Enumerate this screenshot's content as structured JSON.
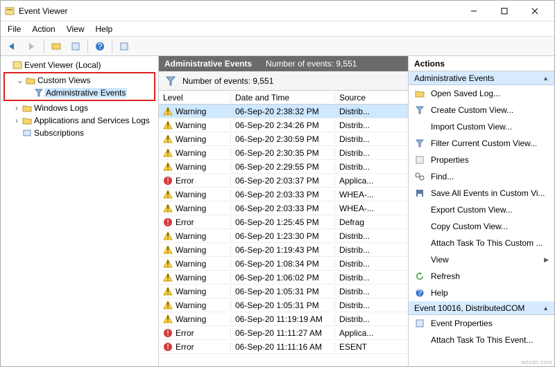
{
  "window": {
    "title": "Event Viewer"
  },
  "menu": [
    "File",
    "Action",
    "View",
    "Help"
  ],
  "tree": {
    "root": "Event Viewer (Local)",
    "custom_views": "Custom Views",
    "admin_events": "Administrative Events",
    "windows_logs": "Windows Logs",
    "apps_logs": "Applications and Services Logs",
    "subscriptions": "Subscriptions"
  },
  "center": {
    "title": "Administrative Events",
    "count_label": "Number of events: 9,551",
    "filter_count": "Number of events: 9,551",
    "columns": {
      "level": "Level",
      "datetime": "Date and Time",
      "source": "Source"
    },
    "rows": [
      {
        "level": "Warning",
        "dt": "06-Sep-20 2:38:32 PM",
        "src": "Distrib..."
      },
      {
        "level": "Warning",
        "dt": "06-Sep-20 2:34:26 PM",
        "src": "Distrib..."
      },
      {
        "level": "Warning",
        "dt": "06-Sep-20 2:30:59 PM",
        "src": "Distrib..."
      },
      {
        "level": "Warning",
        "dt": "06-Sep-20 2:30:35 PM",
        "src": "Distrib..."
      },
      {
        "level": "Warning",
        "dt": "06-Sep-20 2:29:55 PM",
        "src": "Distrib..."
      },
      {
        "level": "Error",
        "dt": "06-Sep-20 2:03:37 PM",
        "src": "Applica..."
      },
      {
        "level": "Warning",
        "dt": "06-Sep-20 2:03:33 PM",
        "src": "WHEA-..."
      },
      {
        "level": "Warning",
        "dt": "06-Sep-20 2:03:33 PM",
        "src": "WHEA-..."
      },
      {
        "level": "Error",
        "dt": "06-Sep-20 1:25:45 PM",
        "src": "Defrag"
      },
      {
        "level": "Warning",
        "dt": "06-Sep-20 1:23:30 PM",
        "src": "Distrib..."
      },
      {
        "level": "Warning",
        "dt": "06-Sep-20 1:19:43 PM",
        "src": "Distrib..."
      },
      {
        "level": "Warning",
        "dt": "06-Sep-20 1:08:34 PM",
        "src": "Distrib..."
      },
      {
        "level": "Warning",
        "dt": "06-Sep-20 1:06:02 PM",
        "src": "Distrib..."
      },
      {
        "level": "Warning",
        "dt": "06-Sep-20 1:05:31 PM",
        "src": "Distrib..."
      },
      {
        "level": "Warning",
        "dt": "06-Sep-20 1:05:31 PM",
        "src": "Distrib..."
      },
      {
        "level": "Warning",
        "dt": "06-Sep-20 11:19:19 AM",
        "src": "Distrib..."
      },
      {
        "level": "Error",
        "dt": "06-Sep-20 11:11:27 AM",
        "src": "Applica..."
      },
      {
        "level": "Error",
        "dt": "06-Sep-20 11:11:16 AM",
        "src": "ESENT"
      }
    ]
  },
  "actions": {
    "header": "Actions",
    "section1": "Administrative Events",
    "items1": [
      "Open Saved Log...",
      "Create Custom View...",
      "Import Custom View...",
      "Filter Current Custom View...",
      "Properties",
      "Find...",
      "Save All Events in Custom Vi...",
      "Export Custom View...",
      "Copy Custom View...",
      "Attach Task To This Custom ...",
      "View",
      "Refresh",
      "Help"
    ],
    "section2": "Event 10016, DistributedCOM",
    "items2": [
      "Event Properties",
      "Attach Task To This Event..."
    ]
  },
  "watermark": "wsxdn.com"
}
